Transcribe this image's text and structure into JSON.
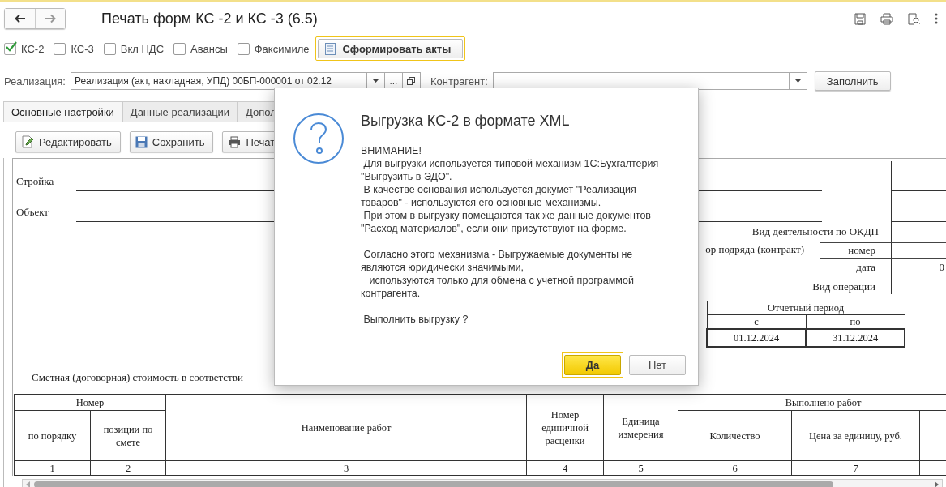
{
  "window": {
    "title": "Печать форм КС -2 и КС -3 (6.5)"
  },
  "options": [
    {
      "label": "КС-2",
      "checked": true
    },
    {
      "label": "КС-3",
      "checked": false
    },
    {
      "label": "Вкл НДС",
      "checked": false
    },
    {
      "label": "Авансы",
      "checked": false
    },
    {
      "label": "Факсимиле",
      "checked": false
    }
  ],
  "generate_button": {
    "label": "Сформировать акты"
  },
  "realization": {
    "label": "Реализация:",
    "value": "Реализация (акт, накладная, УПД) 00БП-000001 от 02.12",
    "more": "..."
  },
  "contractor": {
    "label": "Контрагент:"
  },
  "fill_button": {
    "label": "Заполнить"
  },
  "tabs": [
    {
      "label": "Основные настройки",
      "selected": true
    },
    {
      "label": "Данные реализации",
      "selected": false
    },
    {
      "label": "Допол",
      "selected": false
    }
  ],
  "toolbar": [
    {
      "kind": "edit",
      "label": "Редактировать"
    },
    {
      "kind": "save",
      "label": "Сохранить"
    },
    {
      "kind": "print",
      "label": "Печат"
    }
  ],
  "document": {
    "construction_label": "Стройка",
    "object_label": "Объект",
    "okdp_label": "Вид деятельности по ОКДП",
    "contract_label": "ор подряда (контракт)",
    "number_label": "номер",
    "date_label": "дата",
    "date_value": "0",
    "operation_label": "Вид операции",
    "period": {
      "title": "Отчетный период",
      "from_label": "с",
      "to_label": "по",
      "from": "01.12.2024",
      "to": "31.12.2024"
    },
    "estimate_text": "Сметная (договорная) стоимость в соответстви",
    "table": {
      "groups": [
        {
          "label": "Номер"
        },
        {
          "label": "Выполнено работ"
        }
      ],
      "columns": [
        {
          "label": "по порядку",
          "number": "1"
        },
        {
          "label": "позиции по смете",
          "number": "2"
        },
        {
          "label": "Наименование работ",
          "number": "3"
        },
        {
          "label": "Номер единичной расценки",
          "number": "4"
        },
        {
          "label": "Единица измерения",
          "number": "5"
        },
        {
          "label": "Количество",
          "number": "6"
        },
        {
          "label": "Цена за единицу, руб.",
          "number": "7"
        }
      ]
    }
  },
  "dialog": {
    "title": "Выгрузка КС-2 в формате XML",
    "message": "ВНИМАНИЕ!\n Для выгрузки используется типовой механизм 1С:Бухгалтерия \"Выгрузить в ЭДО\".\n В качестве основания используется докумет \"Реализация товаров\" - используются его основные механизмы.\n При этом в выгрузку помещаются так же данные документов \"Расход материалов\", если они присутствуют на форме.\n\n Согласно этого механизма - Выгружаемые документы не являются юридически значимыми,\n   используются только для обмена с учетной программой контрагента.\n\n Выполнить выгрузку ?",
    "buttons": [
      {
        "label": "Да",
        "default": true
      },
      {
        "label": "Нет",
        "default": false
      }
    ]
  }
}
